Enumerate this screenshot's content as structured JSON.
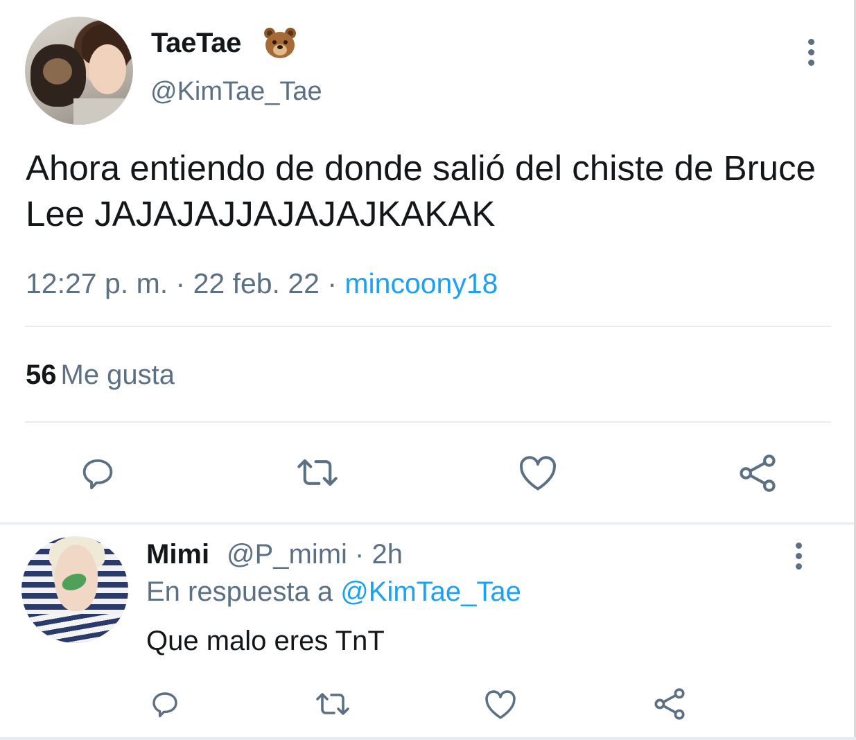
{
  "main_tweet": {
    "display_name": "TaeTae",
    "name_emoji": "bear-face-emoji",
    "handle": "@KimTae_Tae",
    "text": "Ahora entiendo de donde salió del chiste de Bruce Lee JAJAJAJJAJAJAJKAKAK",
    "time": "12:27 p. m.",
    "sep1": " · ",
    "date": "22 feb. 22",
    "sep2": " · ",
    "source": "mincoony18",
    "likes_count": "56",
    "likes_label": "Me gusta",
    "actions": [
      "reply-icon",
      "retweet-icon",
      "like-icon",
      "share-icon"
    ]
  },
  "reply": {
    "display_name": "Mimi",
    "handle_time": "@P_mimi · 2h",
    "replying_prefix": "En respuesta a ",
    "replying_mention": "@KimTae_Tae",
    "text": "Que malo eres TnT",
    "actions": [
      "reply-icon",
      "retweet-icon",
      "like-icon",
      "share-icon"
    ]
  },
  "colors": {
    "text": "#14171a",
    "secondary": "#5b7083",
    "link": "#1da1f2",
    "divider": "#e6ecf0"
  }
}
